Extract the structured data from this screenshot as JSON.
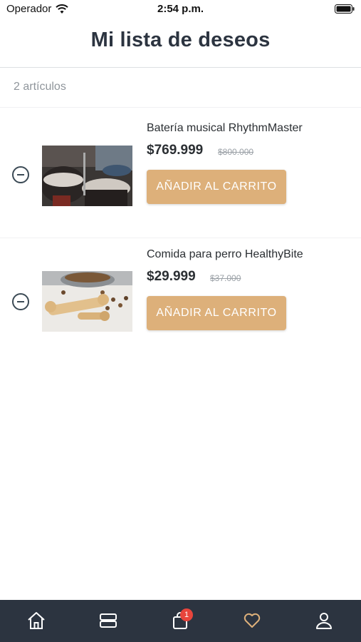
{
  "status_bar": {
    "carrier": "Operador",
    "time": "2:54 p.m."
  },
  "header": {
    "title": "Mi lista de deseos"
  },
  "summary": {
    "count_label": "2 artículos"
  },
  "items": [
    {
      "name": "Batería musical RhythmMaster",
      "price": "$769.999",
      "old_price": "$800.000",
      "button_label": "AÑADIR AL CARRITO",
      "image": "drum-kit-photo"
    },
    {
      "name": "Comida para perro HealthyBite",
      "price": "$29.999",
      "old_price": "$37.000",
      "button_label": "AÑADIR AL CARRITO",
      "image": "dog-food-photo"
    }
  ],
  "tab_bar": {
    "tabs": [
      {
        "icon": "home-icon"
      },
      {
        "icon": "categories-icon"
      },
      {
        "icon": "cart-icon",
        "badge": "1"
      },
      {
        "icon": "heart-icon",
        "active": true
      },
      {
        "icon": "profile-icon"
      }
    ],
    "colors": {
      "background": "#2c3440",
      "icon": "#ffffff",
      "active": "#ddb07a",
      "badge": "#e8453c"
    }
  },
  "colors": {
    "accent": "#ddb07a",
    "title": "#2c3440"
  }
}
